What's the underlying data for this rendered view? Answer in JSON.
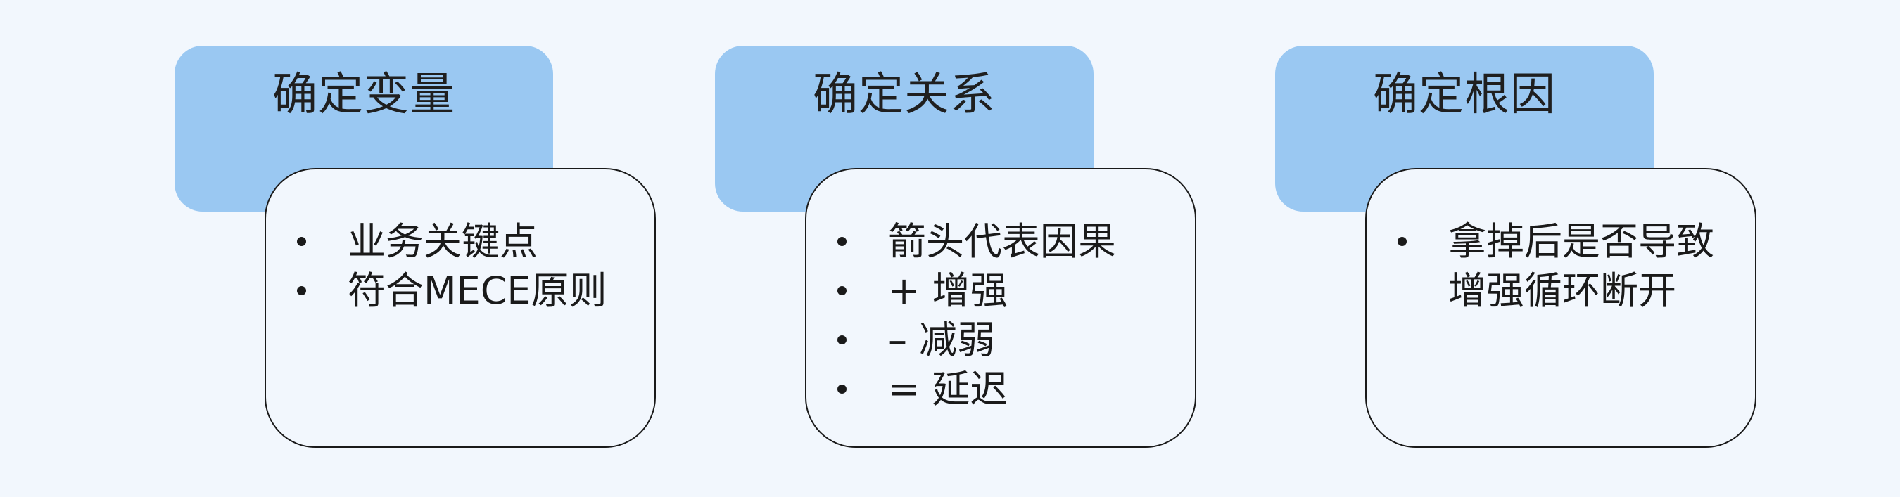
{
  "steps": [
    {
      "title": "确定变量",
      "bullets": [
        "业务关键点",
        "符合MECE原则"
      ]
    },
    {
      "title": "确定关系",
      "bullets": [
        "箭头代表因果",
        "+ 增强",
        "– 减弱",
        "= 延迟"
      ]
    },
    {
      "title": "确定根因",
      "bullets": [
        "拿掉后是否导致增强循环断开"
      ]
    }
  ],
  "colors": {
    "background": "#f2f7fd",
    "header_fill": "#9ac8f2",
    "card_border": "#1a1a1a",
    "text": "#1a1a1a"
  }
}
